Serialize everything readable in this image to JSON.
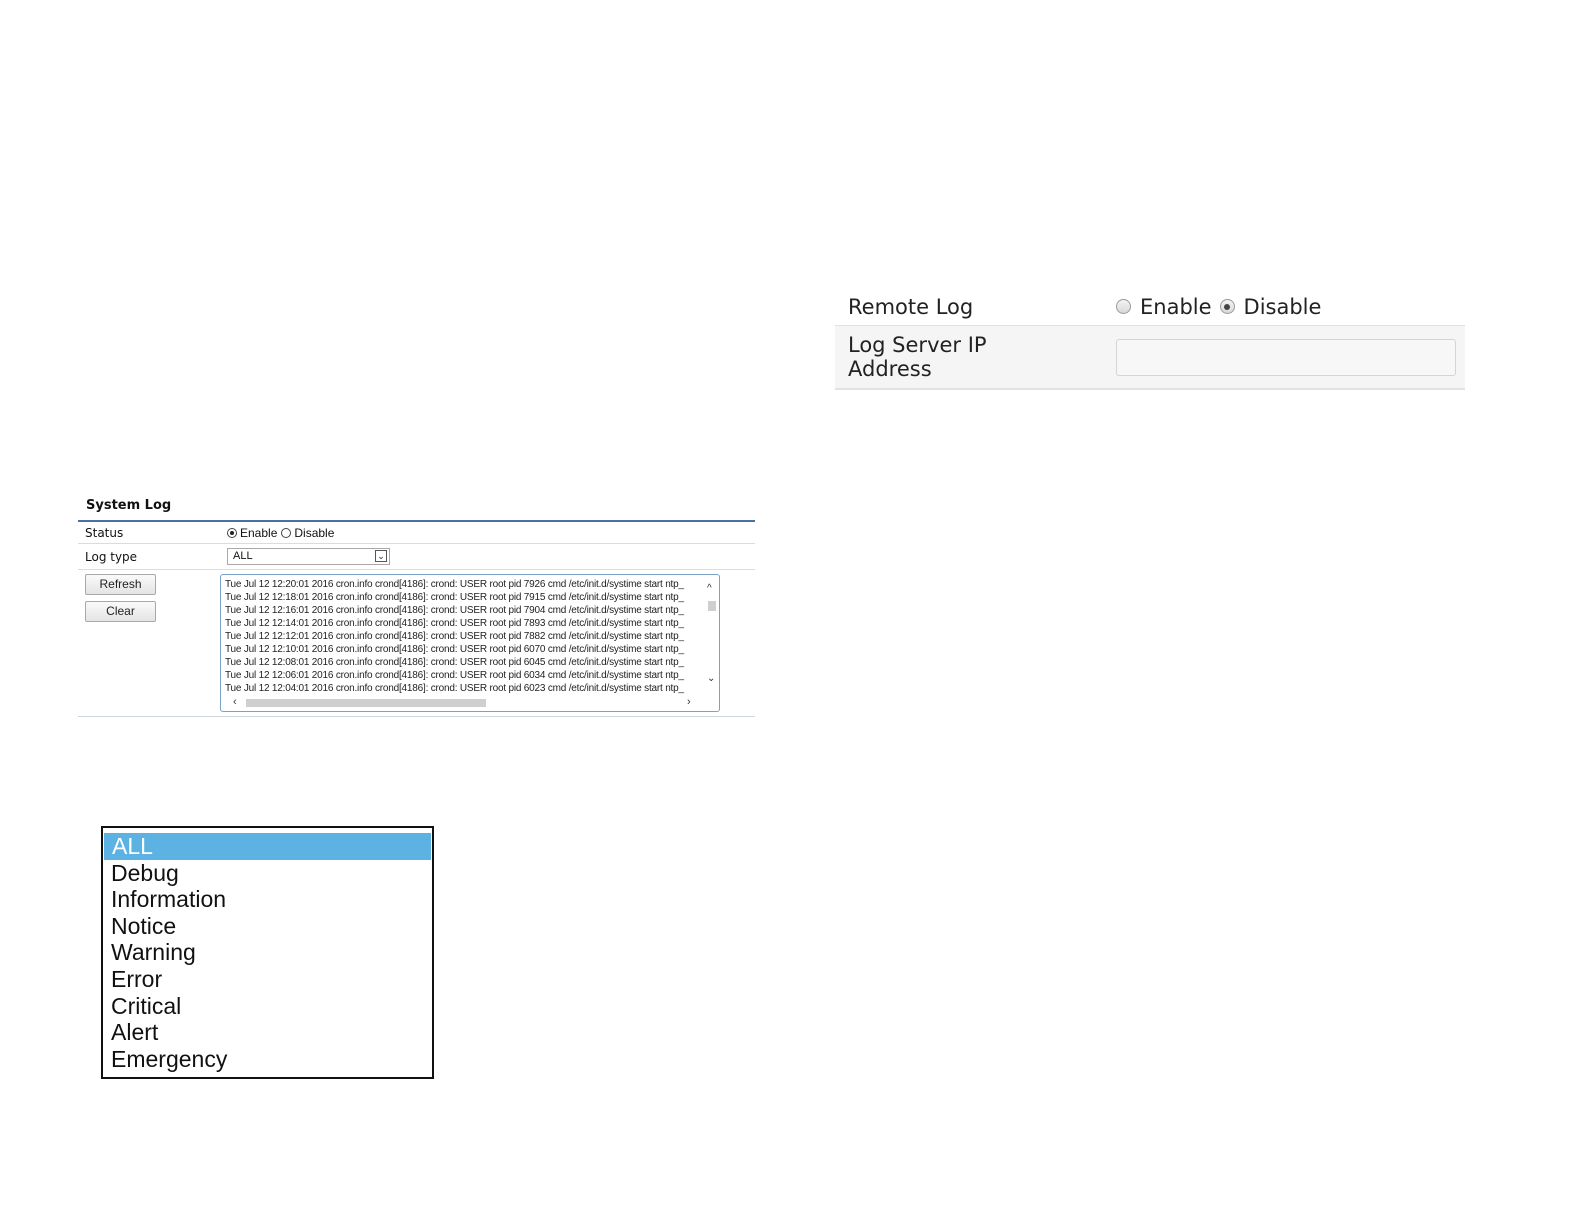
{
  "system_log": {
    "title": "System Log",
    "status_label": "Status",
    "status_options": [
      "Enable",
      "Disable"
    ],
    "status_selected": "Enable",
    "log_type_label": "Log type",
    "log_type_value": "ALL",
    "refresh_label": "Refresh",
    "clear_label": "Clear",
    "log_lines": [
      "Tue Jul 12 12:20:01 2016 cron.info crond[4186]: crond: USER root pid 7926 cmd /etc/init.d/systime start ntp_",
      "Tue Jul 12 12:18:01 2016 cron.info crond[4186]: crond: USER root pid 7915 cmd /etc/init.d/systime start ntp_",
      "Tue Jul 12 12:16:01 2016 cron.info crond[4186]: crond: USER root pid 7904 cmd /etc/init.d/systime start ntp_",
      "Tue Jul 12 12:14:01 2016 cron.info crond[4186]: crond: USER root pid 7893 cmd /etc/init.d/systime start ntp_",
      "Tue Jul 12 12:12:01 2016 cron.info crond[4186]: crond: USER root pid 7882 cmd /etc/init.d/systime start ntp_",
      "Tue Jul 12 12:10:01 2016 cron.info crond[4186]: crond: USER root pid 6070 cmd /etc/init.d/systime start ntp_",
      "Tue Jul 12 12:08:01 2016 cron.info crond[4186]: crond: USER root pid 6045 cmd /etc/init.d/systime start ntp_",
      "Tue Jul 12 12:06:01 2016 cron.info crond[4186]: crond: USER root pid 6034 cmd /etc/init.d/systime start ntp_",
      "Tue Jul 12 12:04:01 2016 cron.info crond[4186]: crond: USER root pid 6023 cmd /etc/init.d/systime start ntp_"
    ]
  },
  "log_type_dropdown": {
    "options": [
      "ALL",
      "Debug",
      "Information",
      "Notice",
      "Warning",
      "Error",
      "Critical",
      "Alert",
      "Emergency"
    ],
    "selected": "ALL",
    "highlight_color": "#5cb3e3"
  },
  "remote_log": {
    "remote_log_label": "Remote Log",
    "options": [
      "Enable",
      "Disable"
    ],
    "selected": "Disable",
    "server_ip_label_line1": "Log Server IP",
    "server_ip_label_line2": "Address",
    "server_ip_value": ""
  },
  "icons": {
    "dropdown_arrow": "chevron-down-icon",
    "scroll_up": "chevron-up-icon",
    "scroll_down": "chevron-down-icon",
    "scroll_left": "chevron-left-icon",
    "scroll_right": "chevron-right-icon"
  }
}
